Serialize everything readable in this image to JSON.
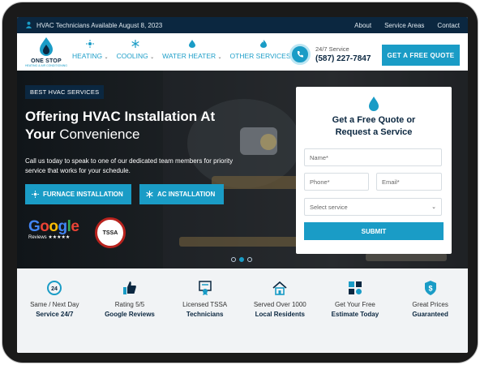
{
  "topbar": {
    "availability": "HVAC Technicians Available August 8, 2023",
    "links": [
      "About",
      "Service Areas",
      "Contact"
    ]
  },
  "logo": {
    "name": "ONE STOP",
    "tagline": "HEATING & AIR CONDITIONING"
  },
  "nav": [
    {
      "label": "HEATING",
      "icon": "sun-icon"
    },
    {
      "label": "COOLING",
      "icon": "snowflake-icon"
    },
    {
      "label": "WATER HEATER",
      "icon": "water-drop-icon"
    },
    {
      "label": "OTHER SERVICES",
      "icon": "flame-icon"
    }
  ],
  "phone": {
    "caption": "24/7 Service",
    "number": "(587) 227-7847"
  },
  "header": {
    "quote_button": "GET A FREE QUOTE"
  },
  "hero": {
    "tag": "BEST HVAC SERVICES",
    "title_bold_1": "Offering HVAC Installation At",
    "title_bold_2": "Your",
    "title_light": " Convenience",
    "description": "Call us today to speak to one of our dedicated team members for priority service that works for your schedule.",
    "button_furnace": "FURNACE INSTALLATION",
    "button_ac": "AC INSTALLATION",
    "google_word": "Google",
    "google_reviews": "Reviews ★★★★★",
    "tssa_text": "TSSA",
    "slides_total": 3,
    "slide_active": 2
  },
  "form": {
    "title_line1": "Get a Free Quote or",
    "title_line2": "Request a Service",
    "name_placeholder": "Name*",
    "phone_placeholder": "Phone*",
    "email_placeholder": "Email*",
    "service_placeholder": "Select service",
    "submit_label": "SUBMIT"
  },
  "features": [
    {
      "icon": "clock-24-icon",
      "line1": "Same / Next Day",
      "line2": "Service 24/7"
    },
    {
      "icon": "thumbs-up-icon",
      "line1": "Rating 5/5",
      "line2": "Google Reviews"
    },
    {
      "icon": "certificate-icon",
      "line1": "Licensed TSSA",
      "line2": "Technicians"
    },
    {
      "icon": "house-icon",
      "line1": "Served Over 1000",
      "line2": "Local Residents"
    },
    {
      "icon": "calculator-icon",
      "line1": "Get Your Free",
      "line2": "Estimate Today"
    },
    {
      "icon": "price-shield-icon",
      "line1": "Great Prices",
      "line2": "Guaranteed"
    }
  ],
  "colors": {
    "accent": "#1a9cc6",
    "navy": "#0b2740",
    "feature_bg": "#f1f3f5"
  }
}
